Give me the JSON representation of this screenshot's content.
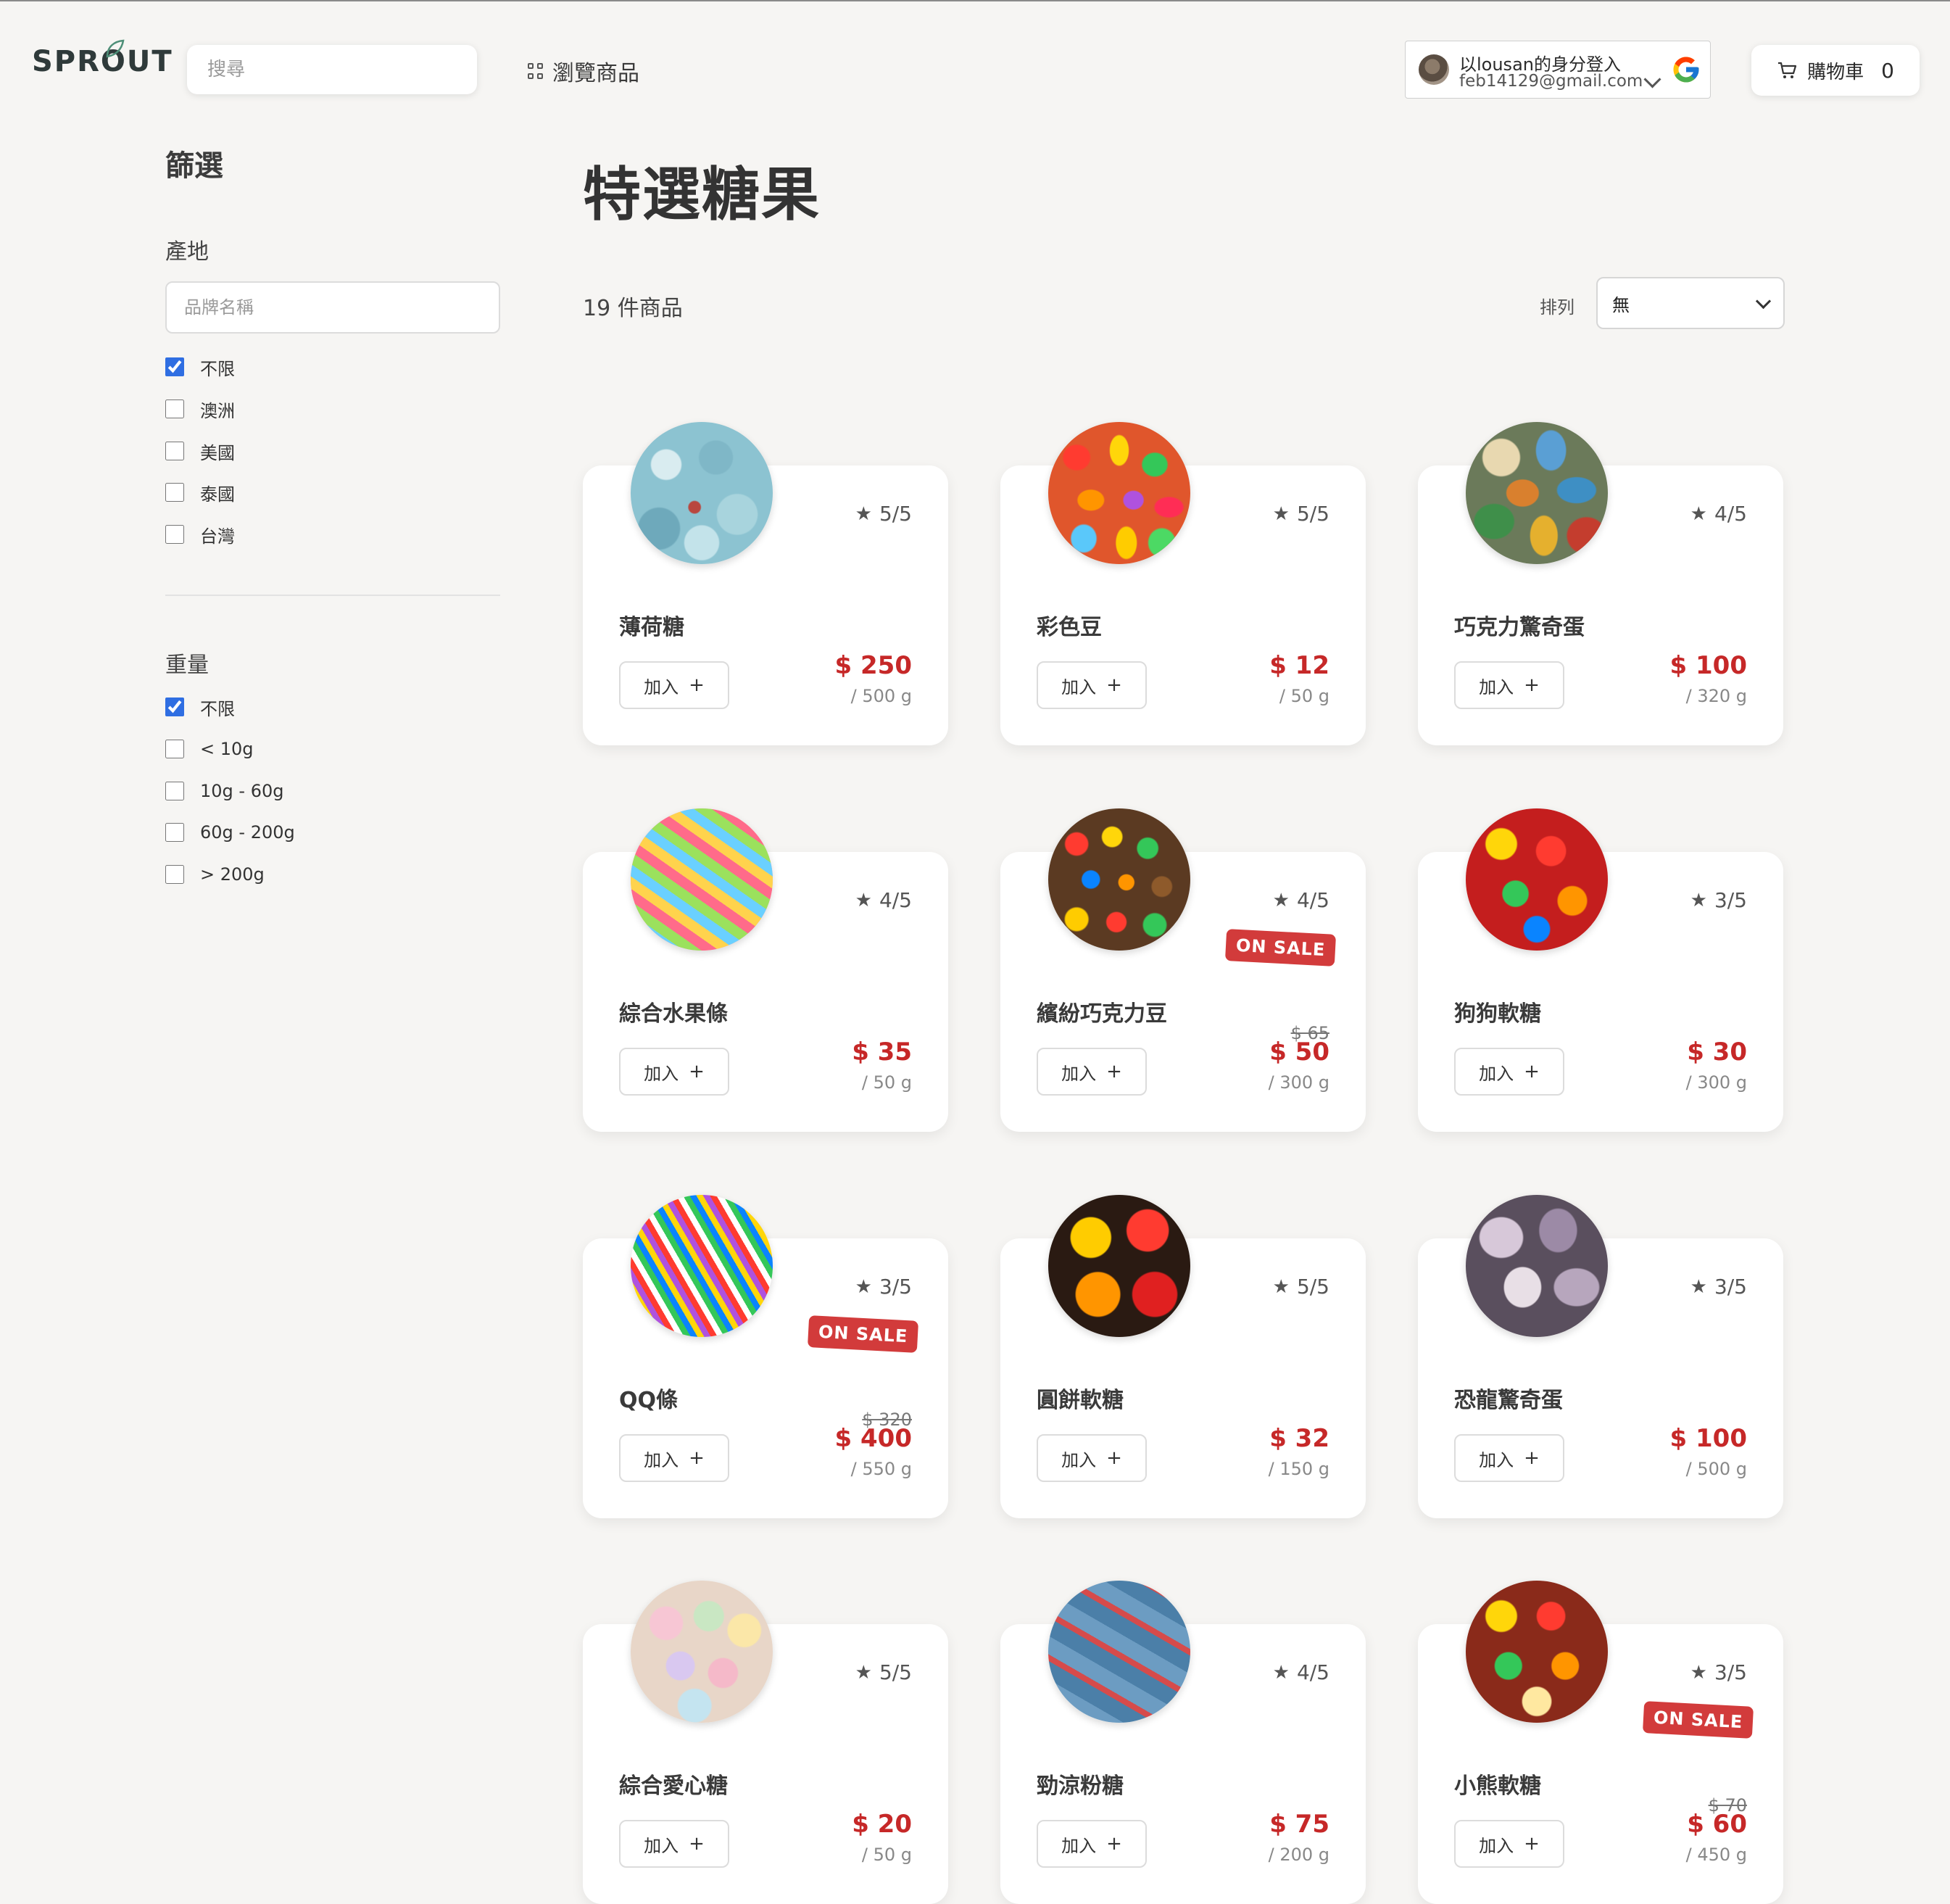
{
  "header": {
    "logo_text": "SPROUT",
    "search_placeholder": "搜尋",
    "browse_label": "瀏覽商品",
    "account_name": "以lousan的身分登入",
    "account_email": "feb14129@gmail.com",
    "cart_label": "購物車",
    "cart_count": "0"
  },
  "sidebar": {
    "title": "篩選",
    "origin_label": "產地",
    "brand_placeholder": "品牌名稱",
    "origin_options": [
      {
        "label": "不限",
        "checked": true
      },
      {
        "label": "澳洲",
        "checked": false
      },
      {
        "label": "美國",
        "checked": false
      },
      {
        "label": "泰國",
        "checked": false
      },
      {
        "label": "台灣",
        "checked": false
      }
    ],
    "weight_label": "重量",
    "weight_options": [
      {
        "label": "不限",
        "checked": true
      },
      {
        "label": "< 10g",
        "checked": false
      },
      {
        "label": "10g - 60g",
        "checked": false
      },
      {
        "label": "60g - 200g",
        "checked": false
      },
      {
        "label": "> 200g",
        "checked": false
      }
    ]
  },
  "main": {
    "title": "特選糖果",
    "count_text": "19 件商品",
    "sort_label": "排列",
    "sort_value": "無",
    "add_label": "加入",
    "sale_label": "ON SALE"
  },
  "products": [
    {
      "name": "薄荷糖",
      "rating": "5/5",
      "price": "$ 250",
      "weight": "/ 500 g",
      "old_price": "",
      "on_sale": false,
      "image": "img-mint"
    },
    {
      "name": "彩色豆",
      "rating": "5/5",
      "price": "$ 12",
      "weight": "/ 50 g",
      "old_price": "",
      "on_sale": false,
      "image": "img-jelly"
    },
    {
      "name": "巧克力驚奇蛋",
      "rating": "4/5",
      "price": "$ 100",
      "weight": "/ 320 g",
      "old_price": "",
      "on_sale": false,
      "image": "img-eggs"
    },
    {
      "name": "綜合水果條",
      "rating": "4/5",
      "price": "$ 35",
      "weight": "/ 50 g",
      "old_price": "",
      "on_sale": false,
      "image": "img-worms"
    },
    {
      "name": "繽紛巧克力豆",
      "rating": "4/5",
      "price": "$ 50",
      "weight": "/ 300 g",
      "old_price": "$ 65",
      "on_sale": true,
      "image": "img-choco"
    },
    {
      "name": "狗狗軟糖",
      "rating": "3/5",
      "price": "$ 30",
      "weight": "/ 300 g",
      "old_price": "",
      "on_sale": false,
      "image": "img-bears-red"
    },
    {
      "name": "QQ條",
      "rating": "3/5",
      "price": "$ 400",
      "weight": "/ 550 g",
      "old_price": "$ 320",
      "on_sale": true,
      "image": "img-sprinkles"
    },
    {
      "name": "圓餅軟糖",
      "rating": "5/5",
      "price": "$ 32",
      "weight": "/ 150 g",
      "old_price": "",
      "on_sale": false,
      "image": "img-gummy"
    },
    {
      "name": "恐龍驚奇蛋",
      "rating": "3/5",
      "price": "$ 100",
      "weight": "/ 500 g",
      "old_price": "",
      "on_sale": false,
      "image": "img-dino"
    },
    {
      "name": "綜合愛心糖",
      "rating": "5/5",
      "price": "$ 20",
      "weight": "/ 50 g",
      "old_price": "",
      "on_sale": false,
      "image": "img-hearts"
    },
    {
      "name": "勁涼粉糖",
      "rating": "4/5",
      "price": "$ 75",
      "weight": "/ 200 g",
      "old_price": "",
      "on_sale": false,
      "image": "img-cola"
    },
    {
      "name": "小熊軟糖",
      "rating": "3/5",
      "price": "$ 60",
      "weight": "/ 450 g",
      "old_price": "$ 70",
      "on_sale": true,
      "image": "img-bears"
    }
  ],
  "colors": {
    "background": "#f6f5f3",
    "price_red": "#c62828",
    "sale_badge": "#d23b3b",
    "checkbox_accent": "#2f6ee2"
  }
}
